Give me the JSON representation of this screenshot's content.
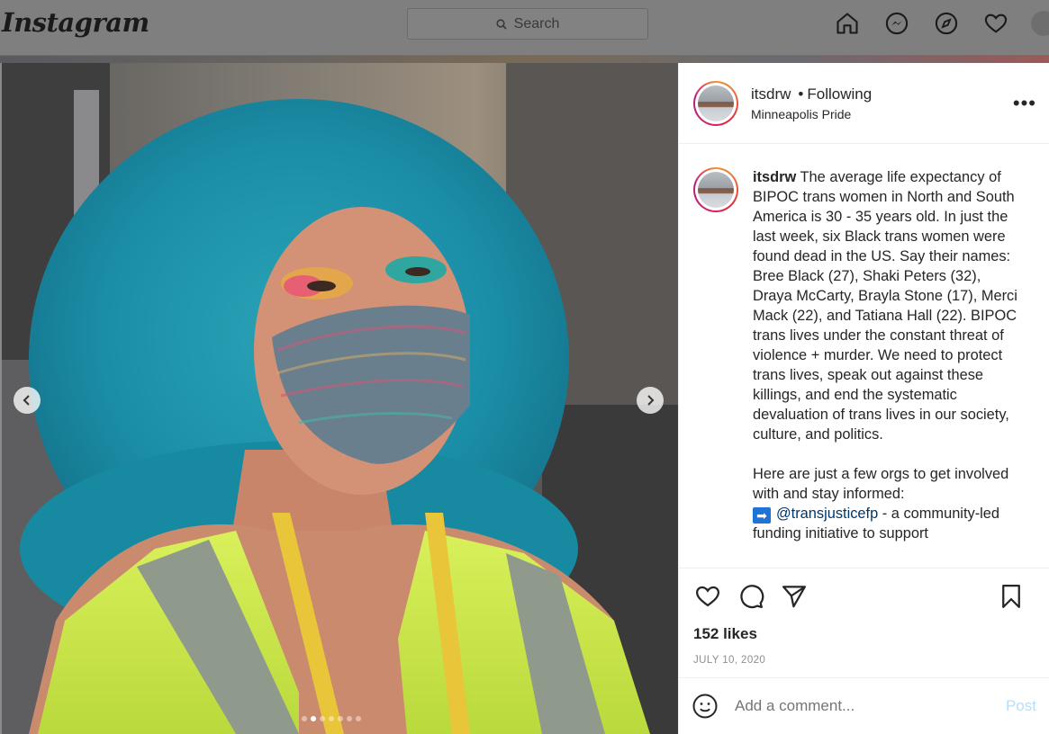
{
  "nav": {
    "logo": "Instagram",
    "search_placeholder": "Search"
  },
  "post": {
    "username": "itsdrw",
    "follow_status": "Following",
    "location": "Minneapolis Pride",
    "caption_paragraph_1": "The average life expectancy of BIPOC trans women in North and South America is 30 - 35 years old. In just the last week, six Black trans women were found dead in the US. Say their names: Bree Black (27), Shaki Peters (32), Draya McCarty, Brayla Stone (17), Merci Mack (22), and Tatiana Hall (22). BIPOC trans lives under the constant threat of violence + murder. We need to protect trans lives, speak out against these killings, and end the systematic devaluation of trans lives in our society, culture, and politics.",
    "caption_paragraph_2": "Here are just a few orgs to get involved with and stay informed:",
    "arrow_emoji": "➡",
    "mention": "@transjusticefp",
    "mention_rest": " - a community-led funding initiative to support",
    "likes": "152 likes",
    "date": "JULY 10, 2020",
    "comment_placeholder": "Add a comment...",
    "post_button": "Post",
    "carousel": {
      "total_images": 7,
      "active_index": 1
    }
  },
  "colors": {
    "link": "#00376b",
    "post_button_disabled": "#b2dffc",
    "muted": "#8e8e8e"
  }
}
